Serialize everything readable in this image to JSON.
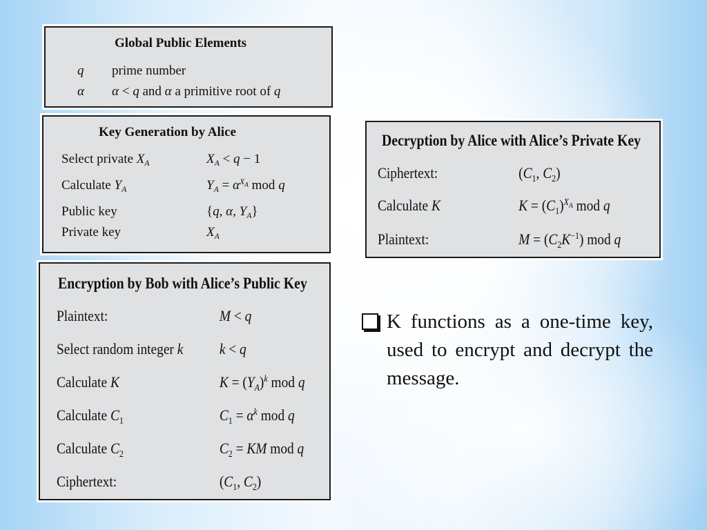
{
  "slide": {
    "global_box": {
      "title": "Global Public Elements",
      "rows": [
        {
          "symbol": "q",
          "desc": "prime number"
        },
        {
          "symbol": "α",
          "desc_parts": [
            "α",
            " < ",
            "q",
            " and ",
            "α",
            " a primitive root of ",
            "q"
          ]
        }
      ]
    },
    "keygen_box": {
      "title": "Key Generation by Alice",
      "rows": [
        {
          "label": "Select private",
          "label_var": "X",
          "label_sub": "A",
          "value": "X_A < q − 1"
        },
        {
          "label": "Calculate",
          "label_var": "Y",
          "label_sub": "A",
          "value": "Y_A = α^{X_A} mod q"
        },
        {
          "label": "Public key",
          "value": "{q, α, Y_A}"
        },
        {
          "label": "Private key",
          "value": "X_A"
        }
      ]
    },
    "decrypt_box": {
      "title": "Decryption by Alice with Alice’s Private Key",
      "rows": [
        {
          "label": "Ciphertext:",
          "value": "(C_1, C_2)"
        },
        {
          "label": "Calculate",
          "label_var": "K",
          "value": "K = (C_1)^{X_A} mod q"
        },
        {
          "label": "Plaintext:",
          "value": "M = (C_2 K^{−1}) mod q"
        }
      ]
    },
    "encrypt_box": {
      "title": "Encryption by Bob with Alice’s Public Key",
      "rows": [
        {
          "label": "Plaintext:",
          "value": "M < q"
        },
        {
          "label": "Select random integer",
          "label_var": "k",
          "value": "k < q"
        },
        {
          "label": "Calculate",
          "label_var": "K",
          "value": "K = (Y_A)^k mod q"
        },
        {
          "label": "Calculate",
          "label_var": "C",
          "label_sub": "1",
          "value": "C_1 = α^k mod q"
        },
        {
          "label": "Calculate",
          "label_var": "C",
          "label_sub": "2",
          "value": "C_2 = KM mod q"
        },
        {
          "label": "Ciphertext:",
          "value": "(C_1, C_2)"
        }
      ]
    },
    "bullet": {
      "icon": "hollow-square-bullet",
      "text": "K functions as a one-time key, used to encrypt and decrypt the message."
    }
  },
  "tokens": {
    "mod": "mod",
    "lt": "<",
    "eq": "=",
    "minus": "−",
    "one": "1",
    "two": "2",
    "A": "A",
    "alpha": "α",
    "q": "q",
    "X": "X",
    "Y": "Y",
    "K": "K",
    "k": "k",
    "C": "C",
    "M": "M",
    "neg1": "−1"
  }
}
